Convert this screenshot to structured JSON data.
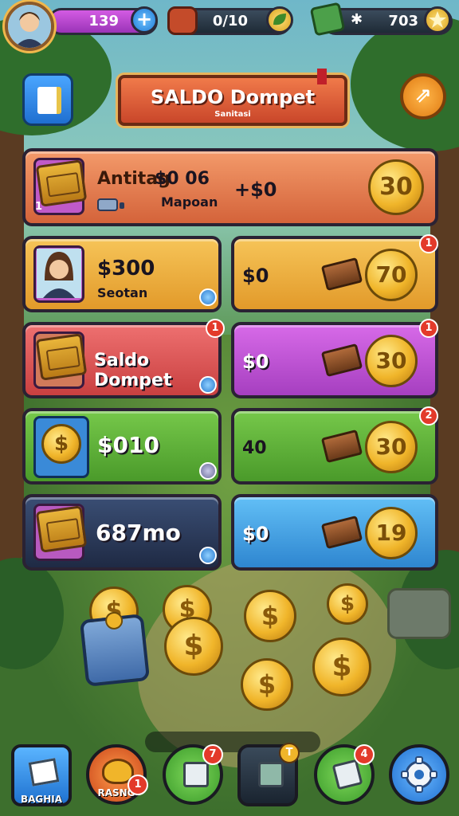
{
  "topbar": {
    "player_value": "139",
    "meat_value": "0/10",
    "cash_value": "703",
    "cash_symbol": "✱",
    "plus_label": "+"
  },
  "header": {
    "title": "SALDO Dompet",
    "subtitle": "Sanitasi",
    "right_button_glyph": "⇗"
  },
  "cards": {
    "row1": {
      "name": "Antitag",
      "amount": "$0 06",
      "sub": "Mapoan",
      "price": "+$0",
      "coin_label": "30",
      "corner_count": "1"
    },
    "row2_left": {
      "amount": "$300",
      "sub": "Seotan"
    },
    "row2_right": {
      "price": "$0",
      "coin_label": "70",
      "badge": "1"
    },
    "row3_left": {
      "title": "Saldo Dompet",
      "badge": "1"
    },
    "row3_right": {
      "price": "$0",
      "coin_label": "30",
      "badge": "1"
    },
    "row4_left": {
      "amount": "$010"
    },
    "row4_right": {
      "price": "40",
      "coin_label": "30",
      "badge": "2"
    },
    "row5_left": {
      "amount": "687mo"
    },
    "row5_right": {
      "price": "$0",
      "coin_label": "19"
    }
  },
  "coins_symbol": "$",
  "nav": {
    "left_label": "BAGHIA",
    "second_label": "RASNG",
    "second_badge": "1",
    "green1_badge": "7",
    "dark_badge": "T",
    "green2_badge": "4"
  },
  "colors": {
    "orange_card": "#e57a4a",
    "yellow_card": "#f0b548",
    "red_card": "#e05a5a",
    "purple_card": "#c75ad8",
    "green_card": "#5fb43a",
    "navy_card": "#2a3a5c",
    "blue_card": "#4aa8e8"
  }
}
